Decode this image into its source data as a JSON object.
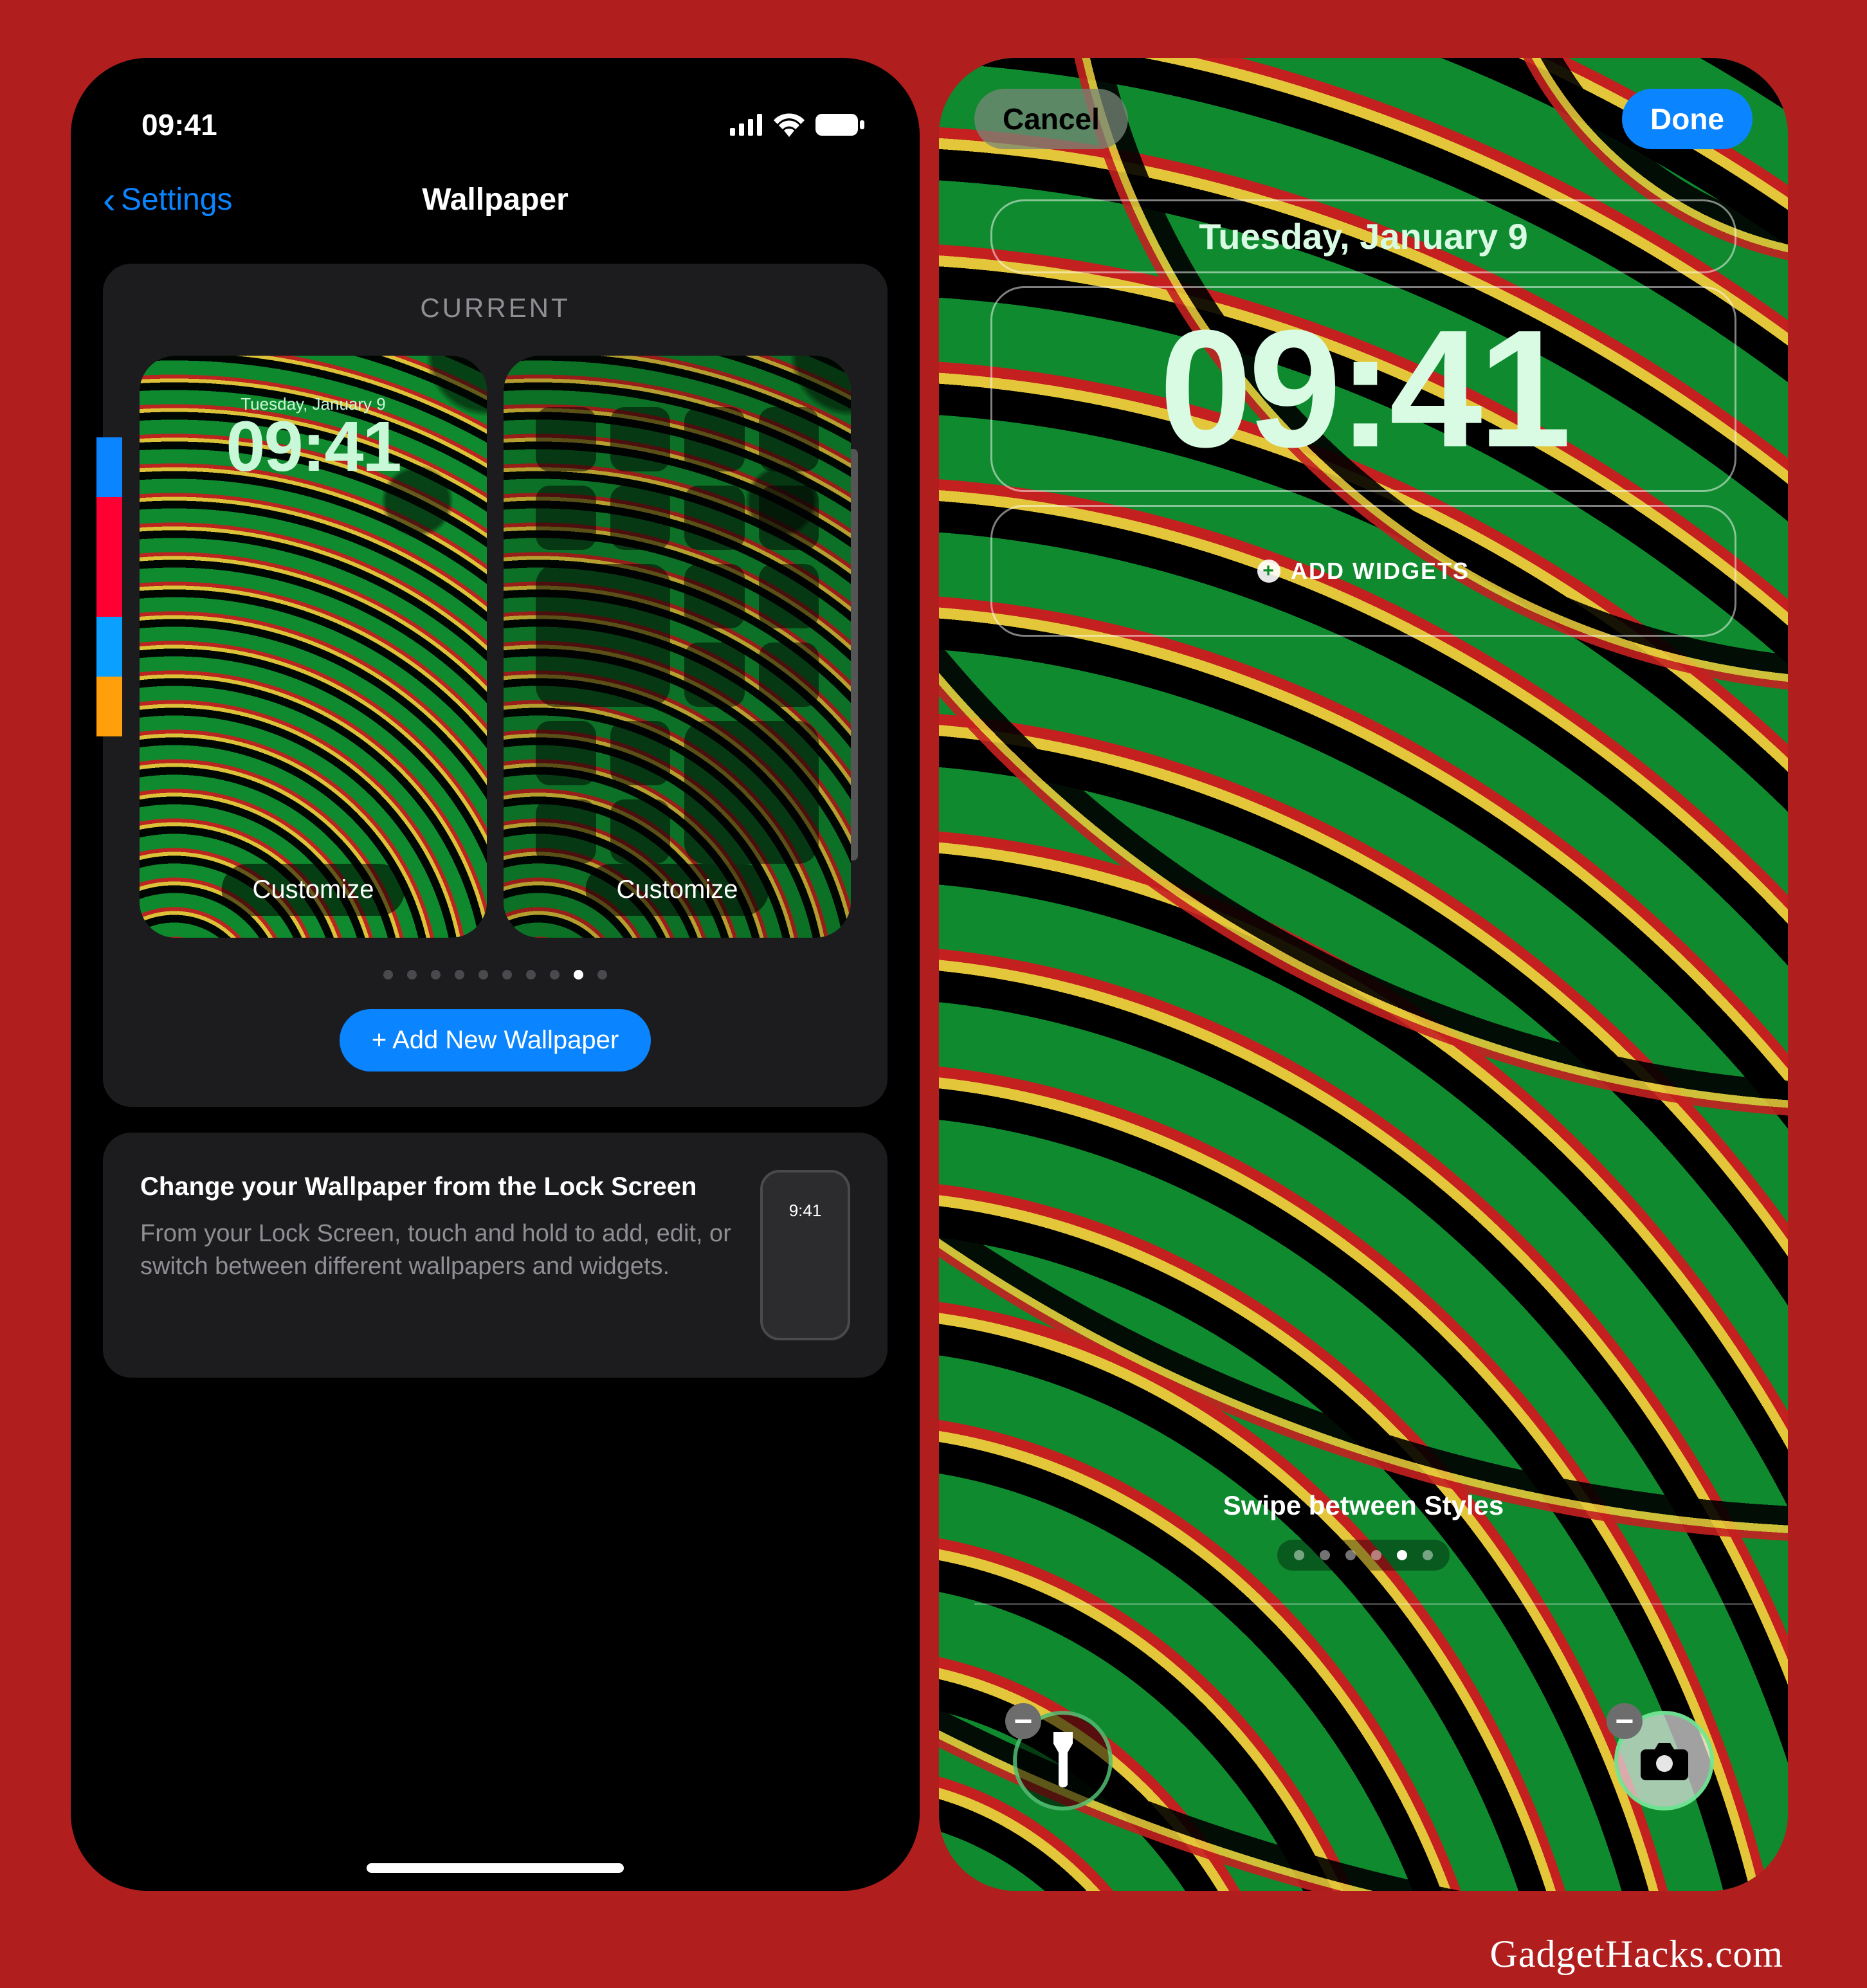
{
  "watermark": "GadgetHacks.com",
  "left": {
    "status_time": "09:41",
    "nav": {
      "back": "Settings",
      "title": "Wallpaper"
    },
    "current_label": "CURRENT",
    "preview": {
      "date": "Tuesday, January 9",
      "time": "09:41",
      "customize_a": "Customize",
      "customize_b": "Customize"
    },
    "page_dots": {
      "count": 10,
      "active_index": 8
    },
    "add_new": "+ Add New Wallpaper",
    "tip": {
      "title": "Change your Wallpaper from the Lock Screen",
      "body": "From your Lock Screen, touch and hold to add, edit, or switch between different wallpapers and widgets.",
      "mini_time": "9:41"
    }
  },
  "right": {
    "cancel": "Cancel",
    "done": "Done",
    "date": "Tuesday, January 9",
    "time": "09:41",
    "add_widgets": "ADD WIDGETS",
    "swipe": "Swipe between Styles",
    "style_dots": {
      "count": 6,
      "active_index": 4
    }
  }
}
